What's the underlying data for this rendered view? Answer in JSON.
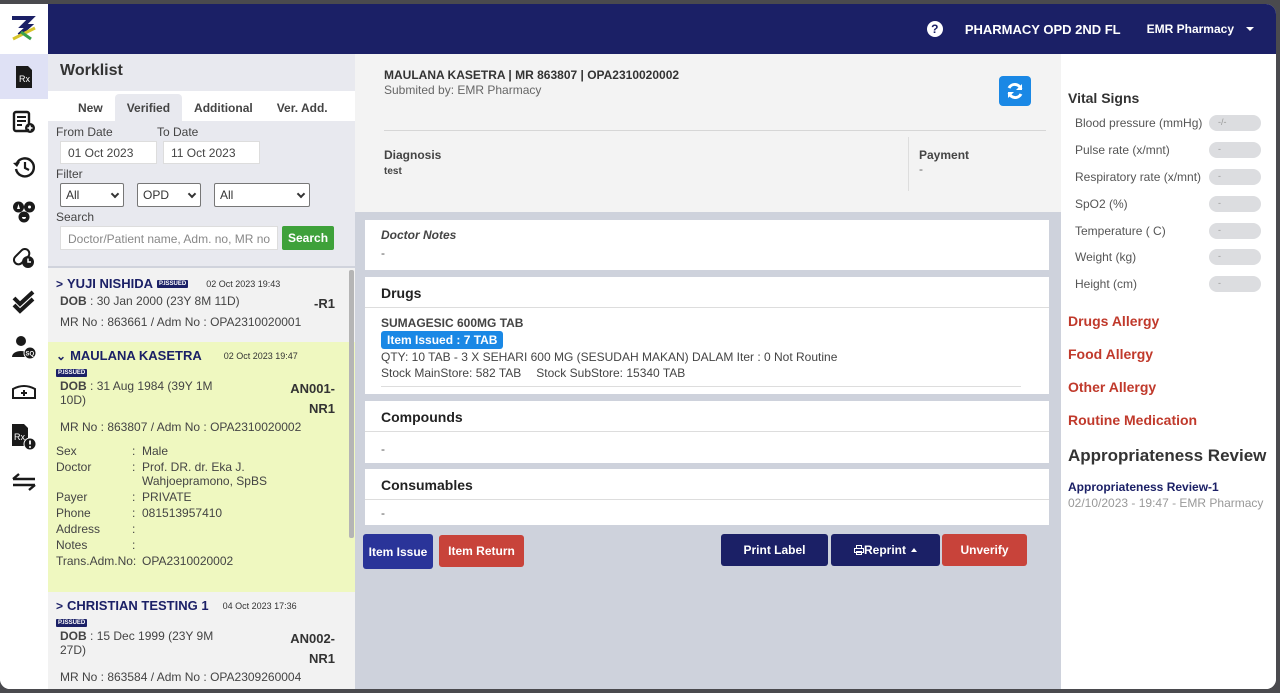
{
  "topbar": {
    "location": "PHARMACY OPD 2ND FL",
    "user": "EMR Pharmacy"
  },
  "rail": {
    "icons": [
      "prescription-icon",
      "add-document-icon",
      "history-icon",
      "lab-radiology-icon",
      "medication-schedule-icon",
      "double-check-icon",
      "user-sq-icon",
      "ambulance-icon",
      "prescription-alert-icon",
      "transfer-icon"
    ]
  },
  "worklist": {
    "title": "Worklist",
    "tabs": [
      {
        "label": "New",
        "active": false
      },
      {
        "label": "Verified",
        "active": true
      },
      {
        "label": "Additional",
        "active": false
      },
      {
        "label": "Ver. Add.",
        "active": false
      }
    ],
    "from_label": "From Date",
    "to_label": "To Date",
    "from_value": "01 Oct 2023",
    "to_value": "11 Oct 2023",
    "filter_label": "Filter",
    "filters": [
      "All",
      "OPD",
      "All"
    ],
    "search_label": "Search",
    "search_placeholder": "Doctor/Patient name, Adm. no, MR no",
    "search_button": "Search",
    "entries": [
      {
        "name": "YUJI NISHIDA",
        "badge": "P.ISSUED",
        "time": "02 Oct 2023 19:43",
        "dob_label": "DOB",
        "dob": "30 Jan 2000 (23Y 8M 11D)",
        "queue": "-R1",
        "mr": "MR No : 863661  /  Adm No : OPA2310020001"
      },
      {
        "name": "MAULANA KASETRA",
        "badge": "P.ISSUED",
        "time": "02 Oct 2023 19:47",
        "dob_label": "DOB",
        "dob": "31 Aug 1984 (39Y 1M 10D)",
        "queue": "AN001-NR1",
        "mr": "MR No : 863807  /  Adm No : OPA2310020002",
        "details": {
          "sex_label": "Sex",
          "sex": "Male",
          "doctor_label": "Doctor",
          "doctor": "Prof. DR. dr. Eka J. Wahjoepramono, SpBS",
          "payer_label": "Payer",
          "payer": "PRIVATE",
          "phone_label": "Phone",
          "phone": "081513957410",
          "address_label": "Address",
          "address": "",
          "notes_label": "Notes",
          "notes": "",
          "trans_label": "Trans.Adm.No:",
          "trans": "OPA2310020002"
        }
      },
      {
        "name": "CHRISTIAN TESTING 1",
        "badge": "P.ISSUED",
        "time": "04 Oct 2023 17:36",
        "dob_label": "DOB",
        "dob": "15 Dec 1999 (23Y 9M 27D)",
        "queue": "AN002-NR1",
        "mr": "MR No : 863584  /  Adm No : OPA2309260004"
      }
    ]
  },
  "patient": {
    "header": "MAULANA KASETRA | MR 863807 | OPA2310020002",
    "submitted": "Submited by: EMR Pharmacy",
    "diagnosis_label": "Diagnosis",
    "diagnosis": "test",
    "payment_label": "Payment",
    "payment": "-",
    "doctor_notes_label": "Doctor Notes",
    "doctor_notes": "-"
  },
  "drugs": {
    "title": "Drugs",
    "items": [
      {
        "name": "SUMAGESIC 600MG TAB",
        "issued": "Item Issued : 7 TAB",
        "qty": "QTY: 10 TAB - 3 X SEHARI 600 MG (SESUDAH MAKAN) DALAM Iter : 0 Not Routine",
        "stock_main": "Stock MainStore: 582 TAB",
        "stock_sub": "Stock SubStore: 15340 TAB"
      }
    ]
  },
  "compounds": {
    "title": "Compounds",
    "value": "-"
  },
  "consumables": {
    "title": "Consumables",
    "value": "-"
  },
  "actions": {
    "item_issue": "Item Issue",
    "item_return": "Item Return",
    "print_label": "Print Label",
    "reprint": "Reprint",
    "unverify": "Unverify"
  },
  "vitals": {
    "title": "Vital Signs",
    "items": [
      {
        "label": "Blood pressure (mmHg)",
        "value": "-/-"
      },
      {
        "label": "Pulse rate (x/mnt)",
        "value": "-"
      },
      {
        "label": "Respiratory rate (x/mnt)",
        "value": "-"
      },
      {
        "label": "SpO2 (%)",
        "value": "-"
      },
      {
        "label": "Temperature ( C)",
        "value": "-"
      },
      {
        "label": "Weight (kg)",
        "value": "-"
      },
      {
        "label": "Height (cm)",
        "value": "-"
      }
    ]
  },
  "allergies": [
    "Drugs Allergy",
    "Food Allergy",
    "Other Allergy",
    "Routine Medication"
  ],
  "review": {
    "title": "Appropriateness Review",
    "items": [
      {
        "label": "Appropriateness Review-1",
        "meta": "02/10/2023 - 19:47 - EMR Pharmacy"
      }
    ]
  },
  "colors": {
    "navy": "#1b2066",
    "accent_blue": "#1a88e5",
    "danger_red": "#c8433a",
    "success_green": "#3ea13a",
    "selected_row": "#eff8c0"
  }
}
